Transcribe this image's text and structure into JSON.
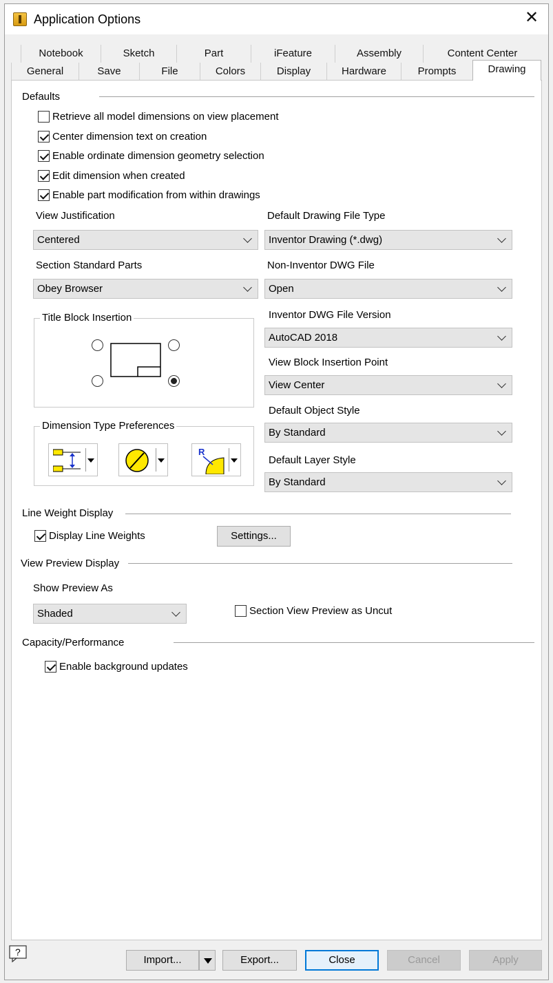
{
  "window": {
    "title": "Application Options"
  },
  "icons": {
    "app": "app-icon",
    "close": "close-icon",
    "help": "help-icon"
  },
  "tabs_row1": [
    "Notebook",
    "Sketch",
    "Part",
    "iFeature",
    "Assembly",
    "Content Center"
  ],
  "tabs_row2": [
    "General",
    "Save",
    "File",
    "Colors",
    "Display",
    "Hardware",
    "Prompts",
    "Drawing"
  ],
  "active_tab": "Drawing",
  "defaults": {
    "title": "Defaults",
    "checkboxes": [
      {
        "label": "Retrieve all model dimensions on view placement",
        "checked": false
      },
      {
        "label": "Center dimension text on creation",
        "checked": true
      },
      {
        "label": "Enable ordinate dimension geometry selection",
        "checked": true
      },
      {
        "label": "Edit dimension when created",
        "checked": true
      },
      {
        "label": "Enable part modification from within drawings",
        "checked": true
      }
    ],
    "view_justification": {
      "label": "View Justification",
      "value": "Centered"
    },
    "section_standard_parts": {
      "label": "Section Standard Parts",
      "value": "Obey Browser"
    },
    "default_drawing_file_type": {
      "label": "Default Drawing File Type",
      "value": "Inventor Drawing (*.dwg)"
    },
    "non_inventor_dwg": {
      "label": "Non-Inventor DWG File",
      "value": "Open"
    },
    "inventor_dwg_version": {
      "label": "Inventor DWG File Version",
      "value": "AutoCAD 2018"
    },
    "view_block_insertion": {
      "label": "View Block Insertion Point",
      "value": "View Center"
    },
    "default_object_style": {
      "label": "Default Object Style",
      "value": "By Standard"
    },
    "default_layer_style": {
      "label": "Default Layer Style",
      "value": "By Standard"
    },
    "title_block": {
      "title": "Title Block Insertion",
      "selected": "bottom-right"
    },
    "dimension_type": {
      "title": "Dimension Type Preferences"
    }
  },
  "line_weight": {
    "title": "Line Weight Display",
    "display_label": "Display Line Weights",
    "display_checked": true,
    "settings_label": "Settings..."
  },
  "view_preview": {
    "title": "View Preview Display",
    "show_as_label": "Show Preview As",
    "show_as_value": "Shaded",
    "section_uncut_label": "Section View Preview as Uncut",
    "section_uncut_checked": false
  },
  "capacity": {
    "title": "Capacity/Performance",
    "bg_label": "Enable background updates",
    "bg_checked": true
  },
  "footer": {
    "import": "Import...",
    "export": "Export...",
    "close": "Close",
    "cancel": "Cancel",
    "apply": "Apply"
  }
}
